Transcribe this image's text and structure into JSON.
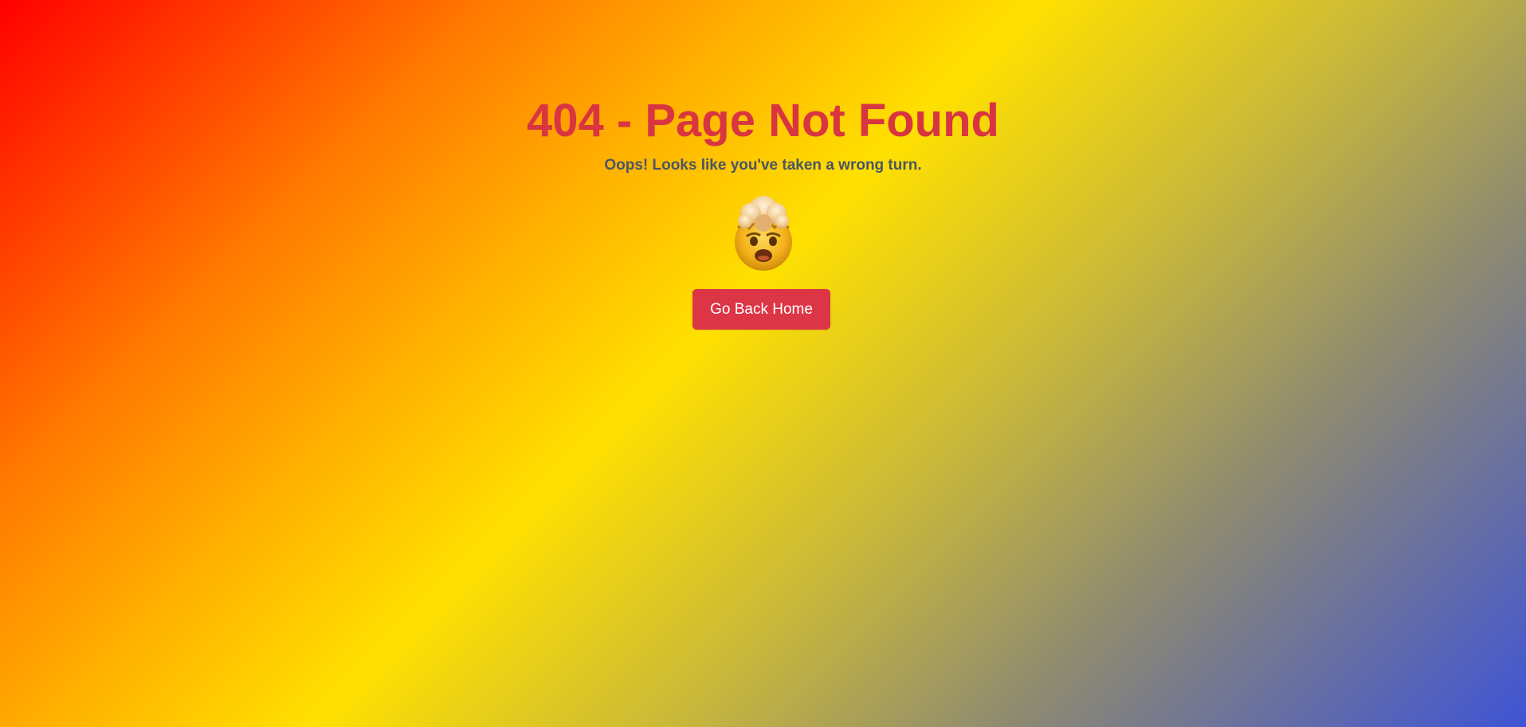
{
  "page": {
    "title": "404 - Page Not Found",
    "subtitle": "Oops! Looks like you've taken a wrong turn.",
    "icon": "exploding-head-icon",
    "button_label": "Go Back Home"
  },
  "colors": {
    "title": "#d83540",
    "subtitle": "#4b5566",
    "button_bg": "#dc3545",
    "button_text": "#ffffff",
    "gradient": [
      "#ff0000",
      "#ff7a00",
      "#ffe000",
      "#8a8775",
      "#3f54d6"
    ]
  }
}
